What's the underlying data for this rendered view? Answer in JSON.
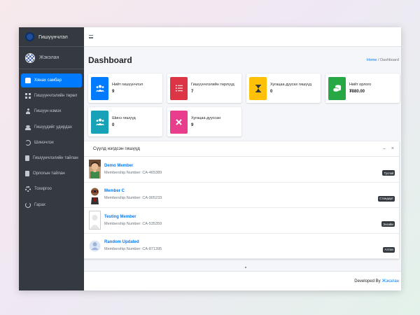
{
  "brand": {
    "name": "Гишүүнчлэл"
  },
  "user": {
    "name": "Жэкэлан"
  },
  "sidebar": {
    "items": [
      {
        "label": "Хянах самбар",
        "icon": "dashboard-icon",
        "active": true
      },
      {
        "label": "Гишүүнчлэлийн төрөл",
        "icon": "grid-icon",
        "active": false
      },
      {
        "label": "Гишүүн нэмэх",
        "icon": "user-plus-icon",
        "active": false
      },
      {
        "label": "Гишүүдийг удирдах",
        "icon": "users-icon",
        "active": false
      },
      {
        "label": "Шинэчлэх",
        "icon": "renew-icon",
        "active": false
      },
      {
        "label": "Гишүүнчлэлийн тайлан",
        "icon": "report-icon",
        "active": false
      },
      {
        "label": "Орлогын тайлан",
        "icon": "document-icon",
        "active": false
      },
      {
        "label": "Тохиргоо",
        "icon": "cog-icon",
        "active": false
      },
      {
        "label": "Гарах",
        "icon": "power-icon",
        "active": false
      }
    ]
  },
  "header": {
    "title": "Dashboard",
    "breadcrumb": {
      "home": "Home",
      "separator": "/",
      "current": "Dashboard"
    }
  },
  "cards": [
    {
      "label": "Нийт гишүүнчлэл",
      "value": "9",
      "color": "#007bff",
      "icon": "users-icon"
    },
    {
      "label": "Гишүүнчлэлийн төрлүүд",
      "value": "7",
      "color": "#dc3545",
      "icon": "list-icon"
    },
    {
      "label": "Хугацаа дуусах гишүүд",
      "value": "0",
      "color": "#ffc107",
      "icon": "hourglass-icon"
    },
    {
      "label": "Нийт орлого",
      "value": "₮880.00",
      "color": "#28a745",
      "icon": "coins-icon"
    },
    {
      "label": "Шинэ гишүүд",
      "value": "0",
      "color": "#17a2b8",
      "icon": "new-users-icon"
    },
    {
      "label": "Хугацаа дууссан",
      "value": "9",
      "color": "#e83e8c",
      "icon": "times-icon"
    }
  ],
  "panel": {
    "title": "Сүүлд нэгдсэн гишүүд",
    "collapse": "–",
    "close": "×",
    "members": [
      {
        "name": "Demo Member",
        "number": "Membership Number: CA-465389",
        "badge": "Тусгай",
        "avatar": "man-avatar"
      },
      {
        "name": "Member C",
        "number": "Membership Number: CA-905233",
        "badge": "Стандарт",
        "avatar": "robot-avatar"
      },
      {
        "name": "Testing Member",
        "number": "Membership Number: CA-535359",
        "badge": "Энгийн",
        "avatar": "blank-avatar"
      },
      {
        "name": "Random Updated",
        "number": "Membership Number: CA-871395",
        "badge": "Алтан",
        "avatar": "default-avatar"
      }
    ]
  },
  "footer": {
    "text": "Developed By",
    "developer": "Жэкэлан"
  }
}
